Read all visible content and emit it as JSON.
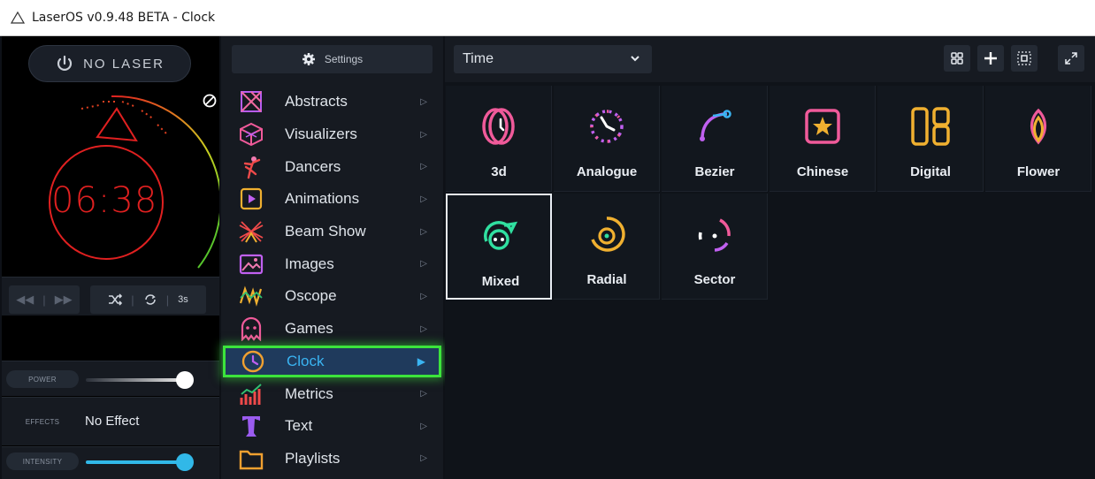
{
  "window": {
    "title": "LaserOS v0.9.48 BETA - Clock",
    "icon": "warning-triangle-icon"
  },
  "preview": {
    "laser_button_label": "NO LASER",
    "clock_display": "06:38",
    "disabled_icon": "no-entry-icon"
  },
  "transport": {
    "prev_icon": "rewind-icon",
    "next_icon": "fast-forward-icon",
    "shuffle_icon": "shuffle-icon",
    "repeat_icon": "repeat-icon",
    "duration_label": "3s"
  },
  "controls": {
    "power_label": "POWER",
    "power_level": 1.0,
    "effects_label": "EFFECTS",
    "effects_value": "No Effect",
    "intensity_label": "INTENSITY",
    "intensity_level": 1.0
  },
  "categories_panel": {
    "settings_label": "Settings",
    "items": [
      {
        "label": "Abstracts",
        "icon": "abstracts-icon"
      },
      {
        "label": "Visualizers",
        "icon": "cube-icon"
      },
      {
        "label": "Dancers",
        "icon": "dancer-icon"
      },
      {
        "label": "Animations",
        "icon": "play-square-icon"
      },
      {
        "label": "Beam Show",
        "icon": "beams-icon"
      },
      {
        "label": "Images",
        "icon": "image-icon"
      },
      {
        "label": "Oscope",
        "icon": "oscope-icon"
      },
      {
        "label": "Games",
        "icon": "ghost-icon"
      },
      {
        "label": "Clock",
        "icon": "clock-icon",
        "active": true
      },
      {
        "label": "Metrics",
        "icon": "metrics-icon"
      },
      {
        "label": "Text",
        "icon": "text-icon"
      },
      {
        "label": "Playlists",
        "icon": "folder-icon"
      }
    ]
  },
  "main": {
    "filter_select": "Time",
    "toolbar_icons": [
      "grid-view-icon",
      "add-icon",
      "select-frame-icon",
      "expand-icon"
    ],
    "tiles": [
      {
        "label": "3d",
        "icon": "3d-clock-icon"
      },
      {
        "label": "Analogue",
        "icon": "analogue-clock-icon"
      },
      {
        "label": "Bezier",
        "icon": "bezier-curve-icon"
      },
      {
        "label": "Chinese",
        "icon": "chinese-star-icon"
      },
      {
        "label": "Digital",
        "icon": "digital-08-icon",
        "glyph": "08"
      },
      {
        "label": "Flower",
        "icon": "flower-icon"
      },
      {
        "label": "Mixed",
        "icon": "mixed-icon",
        "selected": true
      },
      {
        "label": "Radial",
        "icon": "radial-icon"
      },
      {
        "label": "Sector",
        "icon": "sector-icon"
      }
    ]
  },
  "colors": {
    "accent_blue": "#3ab4f2",
    "highlight_green": "#3ce43c",
    "laser_red": "#e02020"
  }
}
